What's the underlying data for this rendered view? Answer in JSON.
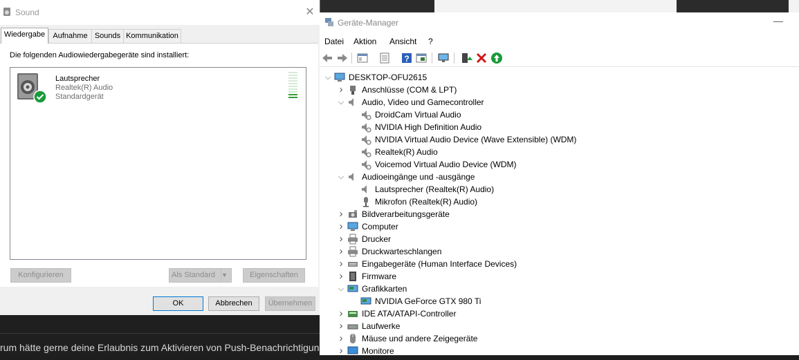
{
  "sound": {
    "title": "Sound",
    "close_glyph": "✕",
    "tabs": [
      "Wiedergabe",
      "Aufnahme",
      "Sounds",
      "Kommunikation"
    ],
    "heading": "Die folgenden Audiowiedergabegeräte sind installiert:",
    "device": {
      "name": "Lautsprecher",
      "driver": "Realtek(R) Audio",
      "status": "Standardgerät",
      "level": 0.2
    },
    "buttons": {
      "configure": "Konfigurieren",
      "set_default": "Als Standard",
      "properties": "Eigenschaften",
      "ok": "OK",
      "cancel": "Abbrechen",
      "apply": "Übernehmen"
    }
  },
  "notification": "rum hätte gerne deine Erlaubnis zum Aktivieren von Push-Benachrichtigungen",
  "devmgr": {
    "title": "Geräte-Manager",
    "minimize_glyph": "—",
    "menu": [
      "Datei",
      "Aktion",
      "Ansicht",
      "?"
    ],
    "toolbar_icons": [
      "back-icon",
      "forward-icon",
      "properties-grid-icon",
      "list-icon",
      "help-icon",
      "view-icon",
      "monitor-icon",
      "update-driver-icon",
      "uninstall-icon",
      "enable-icon"
    ],
    "root": "DESKTOP-OFU2615",
    "categories": [
      {
        "label": "Anschlüsse (COM & LPT)",
        "expanded": false
      },
      {
        "label": "Audio, Video und Gamecontroller",
        "expanded": true,
        "children": [
          "DroidCam Virtual Audio",
          "NVIDIA High Definition Audio",
          "NVIDIA Virtual Audio Device (Wave Extensible) (WDM)",
          "Realtek(R) Audio",
          "Voicemod Virtual Audio Device (WDM)"
        ]
      },
      {
        "label": "Audioeingänge und -ausgänge",
        "expanded": true,
        "children": [
          "Lautsprecher (Realtek(R) Audio)",
          "Mikrofon (Realtek(R) Audio)"
        ]
      },
      {
        "label": "Bildverarbeitungsgeräte",
        "expanded": false
      },
      {
        "label": "Computer",
        "expanded": false
      },
      {
        "label": "Drucker",
        "expanded": false
      },
      {
        "label": "Druckwarteschlangen",
        "expanded": false
      },
      {
        "label": "Eingabegeräte (Human Interface Devices)",
        "expanded": false
      },
      {
        "label": "Firmware",
        "expanded": false
      },
      {
        "label": "Grafikkarten",
        "expanded": true,
        "children": [
          "NVIDIA GeForce GTX 980 Ti"
        ]
      },
      {
        "label": "IDE ATA/ATAPI-Controller",
        "expanded": false
      },
      {
        "label": "Laufwerke",
        "expanded": false
      },
      {
        "label": "Mäuse und andere Zeigegeräte",
        "expanded": false
      },
      {
        "label": "Monitore",
        "expanded": false
      }
    ]
  }
}
